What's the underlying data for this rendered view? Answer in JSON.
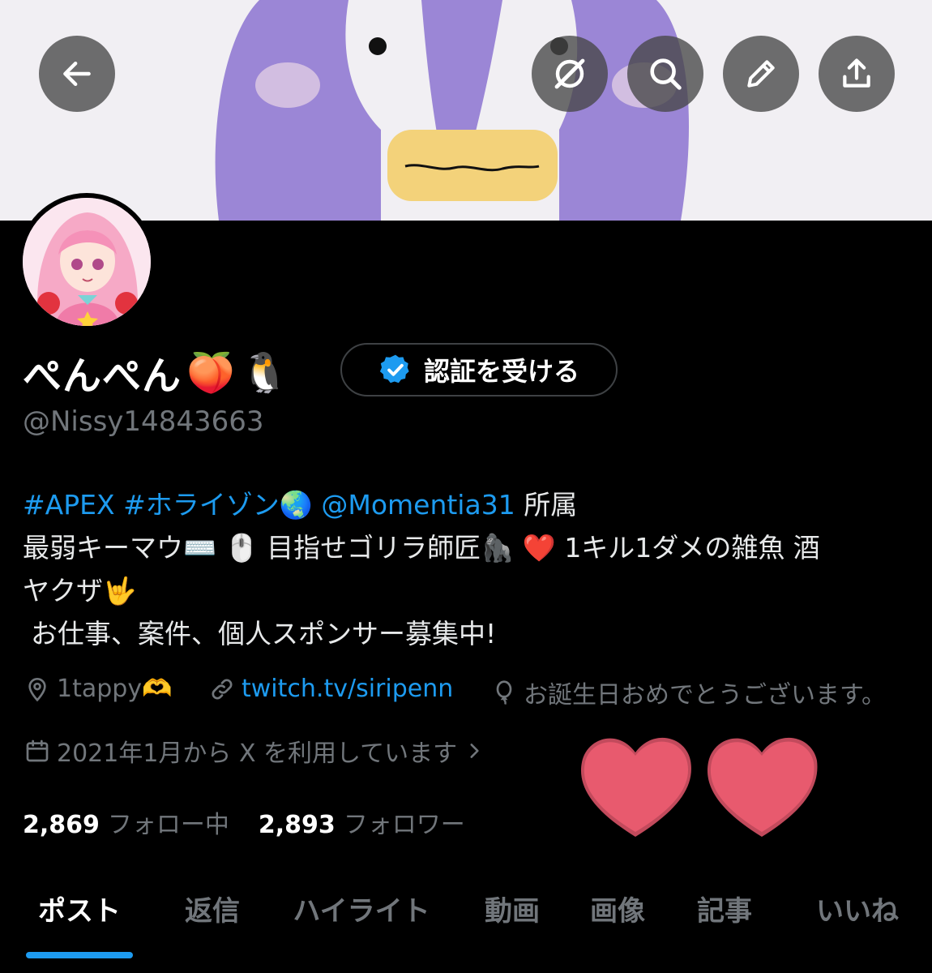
{
  "banner": {
    "description_icon": "penguin-banner"
  },
  "header_buttons": {
    "back": "arrow-left-icon",
    "grok": "grok-icon",
    "search": "search-icon",
    "edit": "pencil-icon",
    "share": "share-icon"
  },
  "profile": {
    "name": "ぺんぺん",
    "name_emojis": [
      "🍑",
      "🐧"
    ],
    "verify_label": "認証を受ける",
    "handle": "@Nissy14843663",
    "bio": {
      "line1_tag1": "#APEX",
      "line1_tag2": "#ホライゾン🌏",
      "line1_mention": "@Momentia31",
      "line1_rest": "所属",
      "line2": "最弱キーマウ⌨️ 🖱️ 目指せゴリラ師匠🦍 ❤️ 1キル1ダメの雑魚 酒",
      "line3": "ヤクザ🤟",
      "line4": "お仕事、案件、個人スポンサー募集中!"
    },
    "location": "1tappy🫶",
    "website": "twitch.tv/siripenn",
    "birthday": "お誕生日おめでとうございます。",
    "joined": "2021年1月から X を利用しています"
  },
  "stats": {
    "following_count": "2,869",
    "following_label": "フォロー中",
    "followers_count": "2,893",
    "followers_label": "フォロワー"
  },
  "tabs": [
    "ポスト",
    "返信",
    "ハイライト",
    "動画",
    "画像",
    "記事",
    "いいね"
  ],
  "colors": {
    "accent": "#1d9bf0",
    "muted": "#71767b",
    "heart": "#e85a6e"
  }
}
